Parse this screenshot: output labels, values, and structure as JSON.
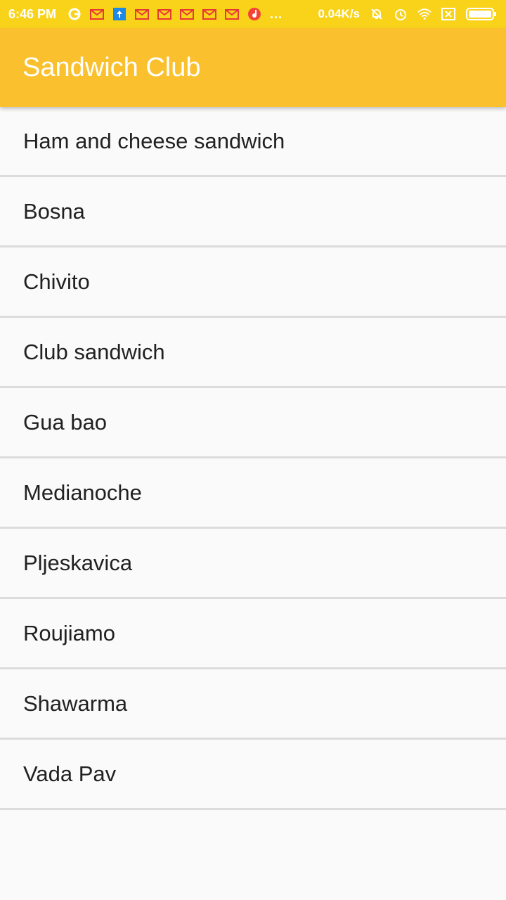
{
  "status_bar": {
    "time": "6:46 PM",
    "left_icons": [
      "google-icon",
      "gmail-icon",
      "upload-icon",
      "gmail-icon",
      "gmail-icon",
      "gmail-icon",
      "gmail-icon",
      "gmail-icon",
      "music-icon"
    ],
    "more": "...",
    "network_speed": "0.04K/s",
    "right_icons": [
      "notifications-off-icon",
      "alarm-icon",
      "wifi-icon",
      "sim-icon",
      "battery-icon"
    ]
  },
  "app_bar": {
    "title": "Sandwich Club"
  },
  "colors": {
    "app_bar": "#fbc02d",
    "status_bar": "#f9d31a",
    "divider": "#dcdcdc"
  },
  "sandwiches": [
    "Ham and cheese sandwich",
    "Bosna",
    "Chivito",
    "Club sandwich",
    "Gua bao",
    "Medianoche",
    "Pljeskavica",
    "Roujiamo",
    "Shawarma",
    "Vada Pav"
  ]
}
